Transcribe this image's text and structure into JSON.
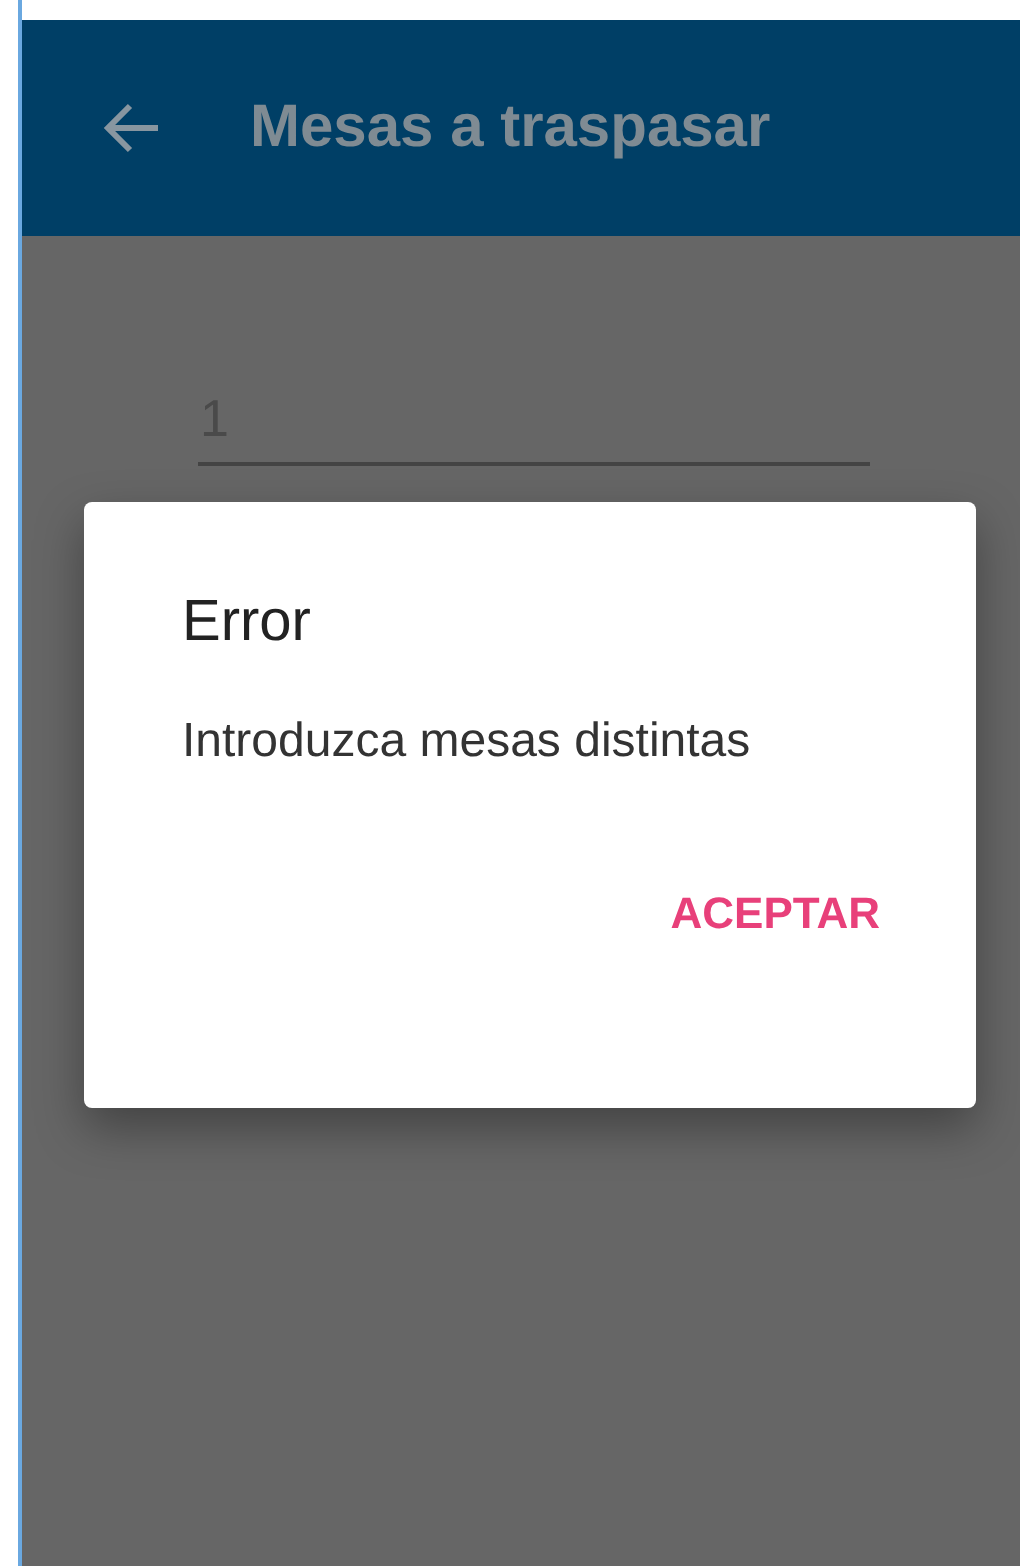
{
  "app_bar": {
    "title": "Mesas a traspasar"
  },
  "field": {
    "value": "1"
  },
  "dialog": {
    "title": "Error",
    "message": "Introduzca mesas distintas",
    "buttons": [
      "ACEPTAR"
    ]
  }
}
